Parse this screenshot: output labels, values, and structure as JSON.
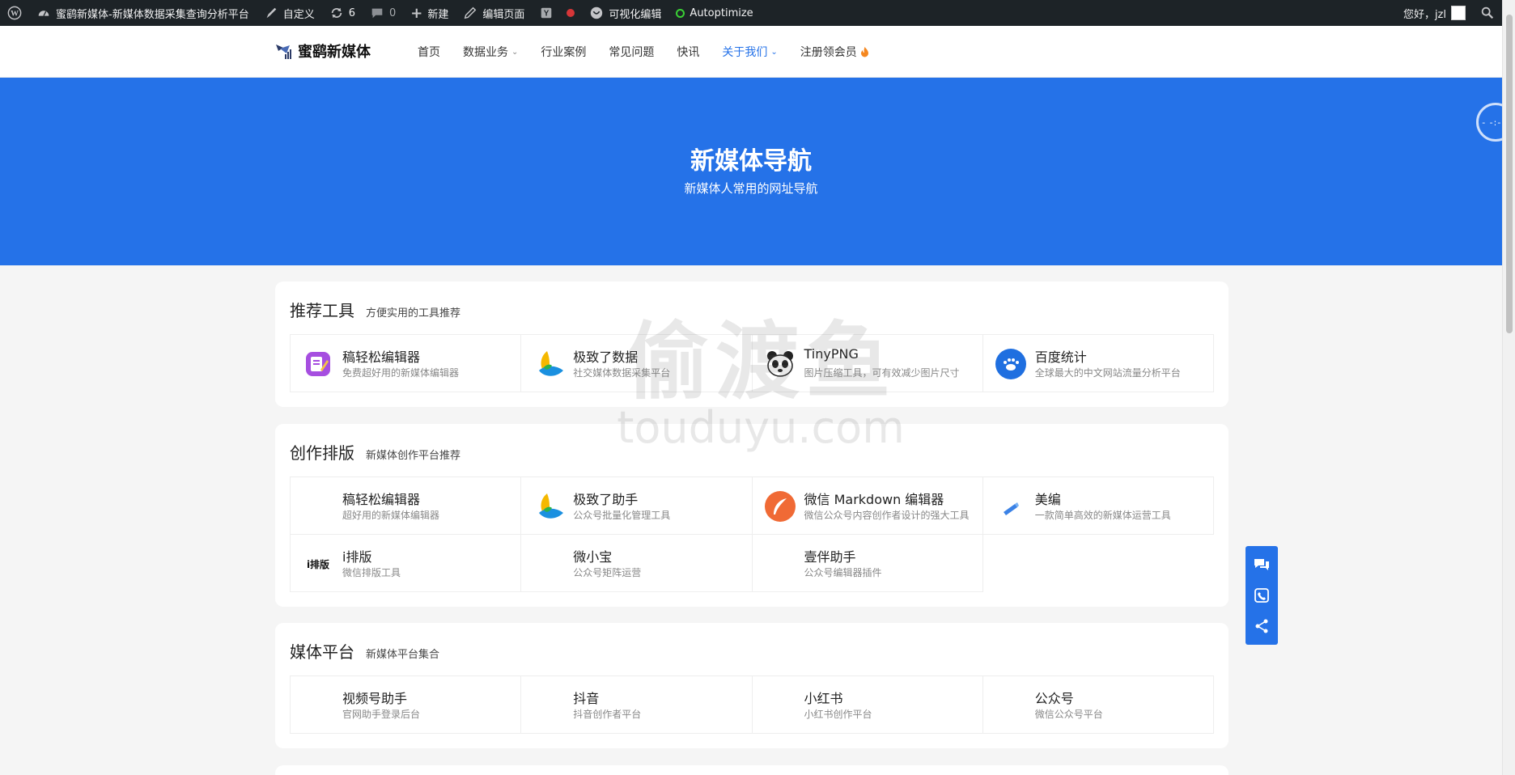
{
  "adminbar": {
    "site_title": "蜜鹞新媒体-新媒体数据采集查询分析平台",
    "customize": "自定义",
    "updates_count": "6",
    "comments_count": "0",
    "new": "新建",
    "edit_page": "编辑页面",
    "visual_edit": "可视化编辑",
    "autoptimize": "Autoptimize",
    "greeting": "您好，jzl"
  },
  "header": {
    "logo_text": "蜜鹞新媒体",
    "nav": [
      {
        "label": "首页"
      },
      {
        "label": "数据业务"
      },
      {
        "label": "行业案例"
      },
      {
        "label": "常见问题"
      },
      {
        "label": "快讯"
      },
      {
        "label": "关于我们"
      },
      {
        "label": "注册领会员"
      }
    ]
  },
  "hero": {
    "title": "新媒体导航",
    "subtitle": "新媒体人常用的网址导航"
  },
  "sections": [
    {
      "title": "推荐工具",
      "subtitle": "方便实用的工具推荐",
      "items": [
        {
          "name": "稿轻松编辑器",
          "desc": "免费超好用的新媒体编辑器",
          "icon": "edit-icon"
        },
        {
          "name": "极致了数据",
          "desc": "社交媒体数据采集平台",
          "icon": "leaf-logo-icon"
        },
        {
          "name": "TinyPNG",
          "desc": "图片压缩工具，可有效减少图片尺寸",
          "icon": "panda-icon"
        },
        {
          "name": "百度统计",
          "desc": "全球最大的中文网站流量分析平台",
          "icon": "baidu-icon"
        }
      ]
    },
    {
      "title": "创作排版",
      "subtitle": "新媒体创作平台推荐",
      "items": [
        {
          "name": "稿轻松编辑器",
          "desc": "超好用的新媒体编辑器",
          "icon": ""
        },
        {
          "name": "极致了助手",
          "desc": "公众号批量化管理工具",
          "icon": "leaf-logo-icon"
        },
        {
          "name": "微信 Markdown 编辑器",
          "desc": "微信公众号内容创作者设计的强大工具",
          "icon": "feather-icon"
        },
        {
          "name": "美编",
          "desc": "一款简单高效的新媒体运营工具",
          "icon": "pen-icon"
        },
        {
          "name": "i排版",
          "desc": "微信排版工具",
          "icon": "ipaiban-icon",
          "icon_text": "i排版"
        },
        {
          "name": "微小宝",
          "desc": "公众号矩阵运营",
          "icon": ""
        },
        {
          "name": "壹伴助手",
          "desc": "公众号编辑器插件",
          "icon": ""
        }
      ]
    },
    {
      "title": "媒体平台",
      "subtitle": "新媒体平台集合",
      "items": [
        {
          "name": "视频号助手",
          "desc": "官网助手登录后台",
          "icon": ""
        },
        {
          "name": "抖音",
          "desc": "抖音创作者平台",
          "icon": ""
        },
        {
          "name": "小红书",
          "desc": "小红书创作平台",
          "icon": ""
        },
        {
          "name": "公众号",
          "desc": "微信公众号平台",
          "icon": ""
        }
      ]
    }
  ],
  "watermark": {
    "line1": "偷渡鱼",
    "line2": "touduyu.com"
  },
  "colors": {
    "brand": "#2572e8",
    "adminbar": "#1d2327"
  }
}
